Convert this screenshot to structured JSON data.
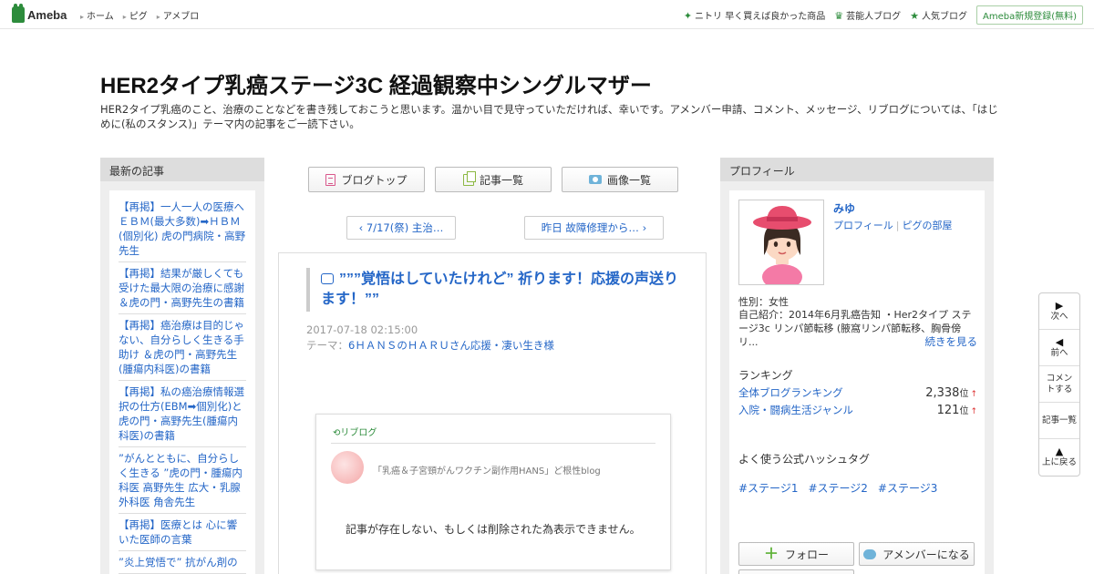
{
  "topbar": {
    "logo": "Ameba",
    "nav": [
      "ホーム",
      "ピグ",
      "アメブロ"
    ],
    "right_links": [
      {
        "icon": "sparkle-icon",
        "label": "ニトリ 早く買えば良かった商品"
      },
      {
        "icon": "crown-icon",
        "label": "芸能人ブログ"
      },
      {
        "icon": "star-icon",
        "label": "人気ブログ"
      }
    ],
    "signup": "Ameba新規登録(無料)"
  },
  "header": {
    "title": "HER2タイプ乳癌ステージ3C 経過観察中シングルマザー",
    "description": "HER2タイプ乳癌のこと、治療のことなどを書き残しておこうと思います。温かい目で見守っていただければ、幸いです。アメンバー申請、コメント、メッセージ、リブログについては、「はじめに(私のスタンス)」テーマ内の記事をご一読下さい。"
  },
  "left_sidebar": {
    "heading": "最新の記事",
    "items": [
      "【再掲】一人一人の医療へ ＥＢＭ(最大多数)➡ＨＢＭ(個別化) 虎の門病院・高野先生",
      "【再掲】結果が厳しくても受けた最大限の治療に感謝 ＆虎の門・高野先生の書籍",
      "【再掲】癌治療は目的じゃない、自分らしく生きる手助け ＆虎の門・高野先生(腫瘍内科医)の書籍",
      "【再掲】私の癌治療情報選択の仕方(EBM➡個別化)と虎の門・高野先生(腫瘍内科医)の書籍",
      "”がんとともに、自分らしく生きる ”虎の門・腫瘍内科医 高野先生 広大・乳腺外科医 角舎先生",
      "【再掲】医療とは 心に響いた医師の言葉",
      "”炎上覚悟で” 抗がん剤の"
    ]
  },
  "center": {
    "nav_buttons": [
      {
        "icon": "document-icon",
        "label": "ブログトップ"
      },
      {
        "icon": "list-icon",
        "label": "記事一覧"
      },
      {
        "icon": "camera-icon",
        "label": "画像一覧"
      }
    ],
    "prev_label": "7/17(祭) 主治…",
    "next_label": "昨日 故障修理から…",
    "entry": {
      "title": "”””覚悟はしていたけれど” 祈ります！応援の声送ります！””",
      "date": "2017-07-18 02:15:00",
      "theme_prefix": "テーマ：",
      "theme": "6ＨＡＮＳのＨＡＲＵさん応援・凄い生き様"
    },
    "reblog": {
      "label": "リブログ",
      "blog_name": "「乳癌＆子宮頸がんワクチン副作用HANS」ど根性blog",
      "message": "記事が存在しない、もしくは削除された為表示できません。"
    }
  },
  "right_sidebar": {
    "heading": "プロフィール",
    "name": "みゆ",
    "profile_link": "プロフィール",
    "pig_link": "ピグの部屋",
    "gender": "性別：女性",
    "intro": "自己紹介：2014年6月乳癌告知 ・Her2タイプ ステージ3c リンパ節転移 (腋窩リンパ節転移、胸骨傍リ...",
    "more": "続きを見る",
    "ranking_heading": "ランキング",
    "rankings": [
      {
        "label": "全体ブログランキング",
        "value": "2,338",
        "unit": "位",
        "trend": "↑"
      },
      {
        "label": "入院・闘病生活ジャンル",
        "value": "121",
        "unit": "位",
        "trend": "↑"
      }
    ],
    "hashtag_heading": "よく使う公式ハッシュタグ",
    "hashtags": [
      "#ステージ1",
      "#ステージ2",
      "#ステージ3"
    ],
    "follow": "フォロー",
    "amember": "アメンバーになる"
  },
  "float_nav": {
    "next": "次へ",
    "prev": "前へ",
    "comment": "コメントする",
    "list": "記事一覧",
    "top": "上に戻る"
  },
  "colors": {
    "link": "#2466c7",
    "brand": "#2d8c3c",
    "rank_up": "#dd3333"
  }
}
